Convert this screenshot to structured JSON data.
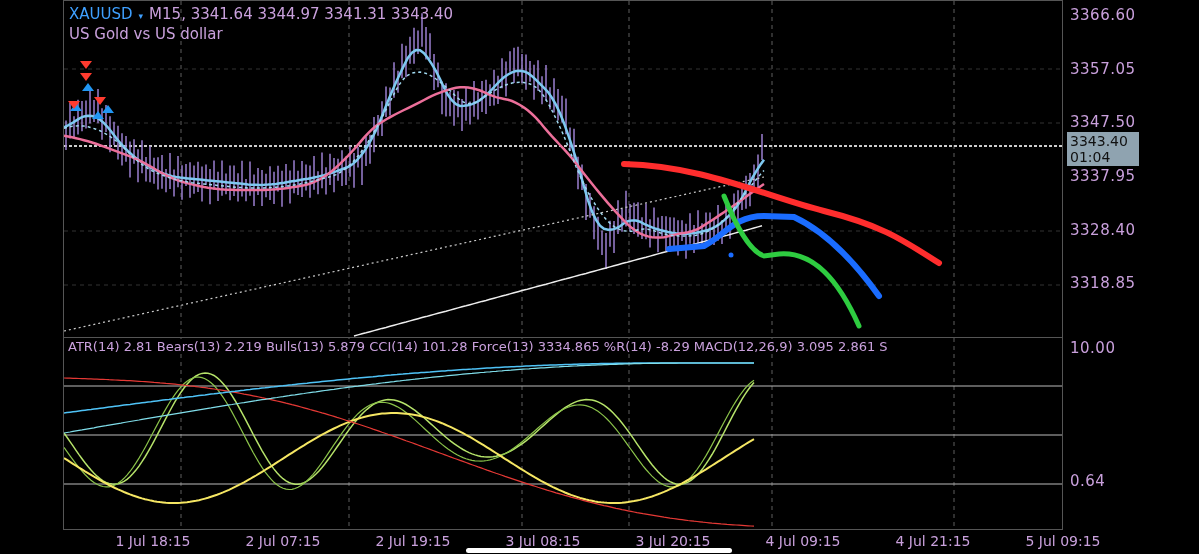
{
  "header": {
    "symbol": "XAUUSD",
    "caret": "▾",
    "timeframe_ohlc": "M15, 3341.64 3344.97 3341.31 3343.40",
    "description": "US Gold vs US dollar"
  },
  "price_axis": [
    "3366.60",
    "3357.05",
    "3347.50",
    "3337.95",
    "3328.40",
    "3318.85"
  ],
  "current_price": {
    "price": "3343.40",
    "countdown": "01:04"
  },
  "indicator_legend": "ATR(14) 2.81 Bears(13) 2.219 Bulls(13) 5.879 CCI(14) 101.28 Force(13) 3334.865 %R(14) -8.29 MACD(12,26,9) 3.095 2.861 S",
  "indicator_axis": [
    "10.00",
    "0.64"
  ],
  "time_axis": [
    "1 Jul 18:15",
    "2 Jul 07:15",
    "2 Jul 19:15",
    "3 Jul 08:15",
    "3 Jul 20:15",
    "4 Jul 09:15",
    "4 Jul 21:15",
    "5 Jul 09:15"
  ]
}
